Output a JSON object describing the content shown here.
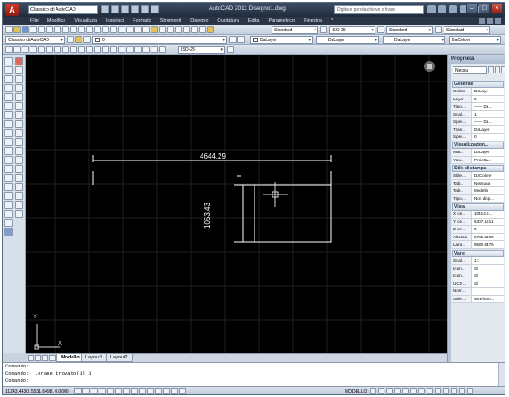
{
  "window": {
    "title": "AutoCAD 2011   Disegno1.dwg",
    "workspace": "Classico di AutoCAD",
    "search_placeholder": "Digitare parola chiave o frase"
  },
  "menu": [
    "File",
    "Modifica",
    "Visualizza",
    "Inserisci",
    "Formato",
    "Strumenti",
    "Disegno",
    "Quotatura",
    "Edita",
    "Parametrico",
    "Finestra",
    "?"
  ],
  "toolbar": {
    "text_style": "Standard",
    "dim_style": "ISO-25",
    "table_style": "Standard",
    "mleader_style": "Standard",
    "workspace_combo": "Classico di AutoCAD",
    "layer_combo": "0",
    "color_combo": "DaLayer",
    "linetype_combo": "DaLayer",
    "lineweight_combo": "DaLayer",
    "plotstyle_combo": "DaColore",
    "dim_style2": "ISO-25"
  },
  "drawing": {
    "dim_horizontal": "4644.29",
    "dim_vertical": "1053.43",
    "ucs_y": "Y",
    "ucs_x": "X"
  },
  "tabs": {
    "model": "Modello",
    "layout1": "Layout1",
    "layout2": "Layout2"
  },
  "properties": {
    "title": "Proprietà",
    "selection": "Nessu",
    "sections": [
      {
        "title": "Generale",
        "rows": [
          [
            "Colore",
            "DaLaye"
          ],
          [
            "Layer",
            "0"
          ],
          [
            "Tipo ...",
            "—— Da..."
          ],
          [
            "Scal...",
            "1"
          ],
          [
            "Spes...",
            "—— Da..."
          ],
          [
            "Tras...",
            "DaLayer"
          ],
          [
            "Spes...",
            "0"
          ]
        ]
      },
      {
        "title": "Visualizzazion...",
        "rows": [
          [
            "Mat...",
            "DaLayer"
          ],
          [
            "You...",
            "Proietta..."
          ]
        ]
      },
      {
        "title": "Stile di stampa",
        "rows": [
          [
            "Stile ...",
            "DaColore"
          ],
          [
            "Tab...",
            "Nessuna"
          ],
          [
            "Tab...",
            "Modello"
          ],
          [
            "Tipo ...",
            "Non disp..."
          ]
        ]
      },
      {
        "title": "Vista",
        "rows": [
          [
            "X ce...",
            "10414.6..."
          ],
          [
            "Y ce...",
            "5307.1611"
          ],
          [
            "Z ce...",
            "0"
          ],
          [
            "Altezza",
            "5782.5195"
          ],
          [
            "Larg...",
            "9530.6475"
          ]
        ]
      },
      {
        "title": "Varie",
        "rows": [
          [
            "Scal...",
            "1:1"
          ],
          [
            "Icon...",
            "Sì"
          ],
          [
            "Icon...",
            "Sì"
          ],
          [
            "UCS ...",
            "Sì"
          ],
          [
            "Nom...",
            ""
          ],
          [
            "Stile ...",
            "Wirefram..."
          ]
        ]
      }
    ]
  },
  "command": {
    "line1": "Comando:",
    "line2": "Comando: _.erase trovato(i) 1",
    "line3": "Comando:"
  },
  "status": {
    "coords": "11243.4430, 5531.6498, 0.0000",
    "model": "MODELLO"
  }
}
